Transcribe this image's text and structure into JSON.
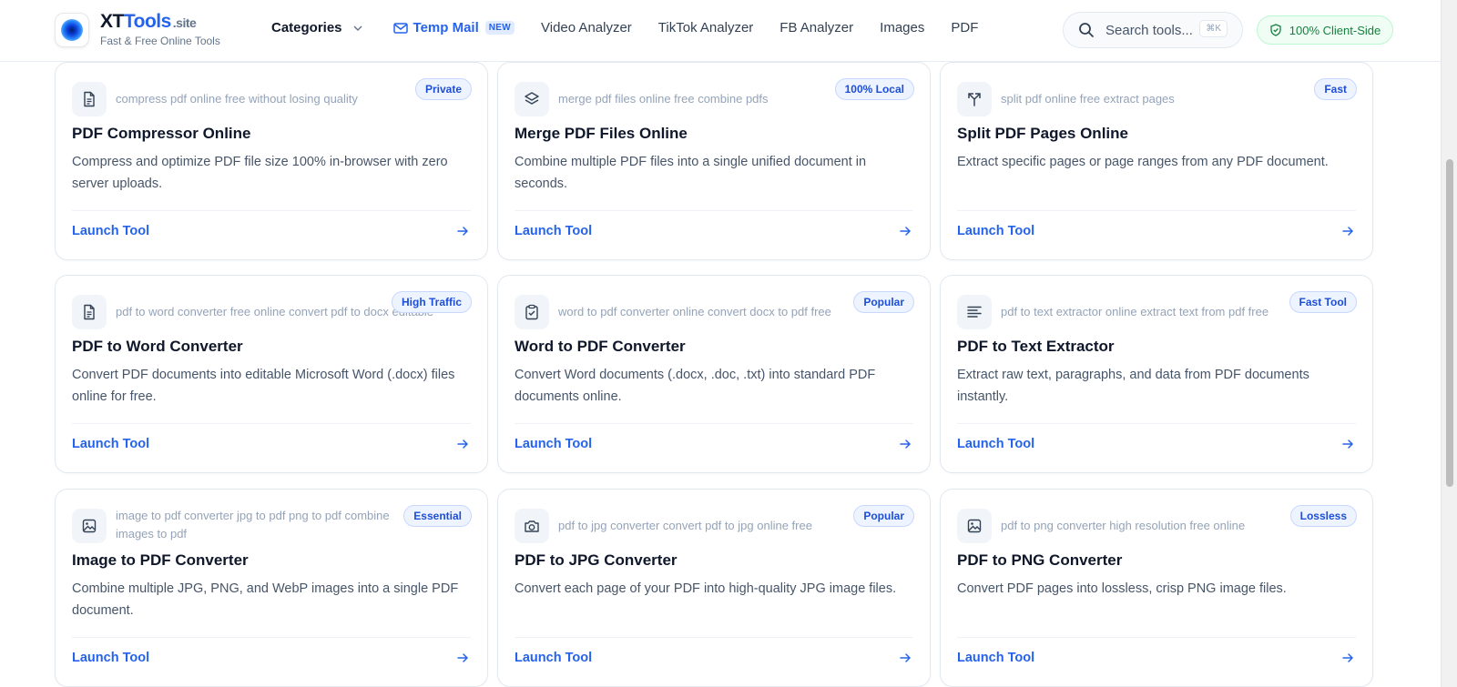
{
  "brand": {
    "name_part1": "XT",
    "name_part2": "Tools",
    "tld": ".site",
    "tagline": "Fast & Free Online Tools"
  },
  "nav": {
    "categories": "Categories",
    "temp_mail": "Temp Mail",
    "new_badge": "NEW",
    "video_analyzer": "Video Analyzer",
    "tiktok_analyzer": "TikTok Analyzer",
    "fb_analyzer": "FB Analyzer",
    "images": "Images",
    "pdf": "PDF"
  },
  "search": {
    "placeholder": "Search tools...",
    "shortcut": "⌘K"
  },
  "client_badge": "100% Client-Side",
  "colors": {
    "accent": "#2563eb",
    "success": "#15803d",
    "badge_bg": "#eef4ff"
  },
  "cards": [
    {
      "icon": "document-icon",
      "keywords": "compress pdf online free without losing quality",
      "badge": "Private",
      "title": "PDF Compressor Online",
      "description": "Compress and optimize PDF file size 100% in-browser with zero server uploads.",
      "cta": "Launch Tool"
    },
    {
      "icon": "layers-icon",
      "keywords": "merge pdf files online free combine pdfs",
      "badge": "100% Local",
      "title": "Merge PDF Files Online",
      "description": "Combine multiple PDF files into a single unified document in seconds.",
      "cta": "Launch Tool"
    },
    {
      "icon": "split-icon",
      "keywords": "split pdf online free extract pages",
      "badge": "Fast",
      "title": "Split PDF Pages Online",
      "description": "Extract specific pages or page ranges from any PDF document.",
      "cta": "Launch Tool"
    },
    {
      "icon": "document-icon",
      "keywords": "pdf to word converter free online convert pdf to docx editable",
      "badge": "High Traffic",
      "title": "PDF to Word Converter",
      "description": "Convert PDF documents into editable Microsoft Word (.docx) files online for free.",
      "cta": "Launch Tool"
    },
    {
      "icon": "clipboard-check-icon",
      "keywords": "word to pdf converter online convert docx to pdf free",
      "badge": "Popular",
      "title": "Word to PDF Converter",
      "description": "Convert Word documents (.docx, .doc, .txt) into standard PDF documents online.",
      "cta": "Launch Tool"
    },
    {
      "icon": "text-align-icon",
      "keywords": "pdf to text extractor online extract text from pdf free",
      "badge": "Fast Tool",
      "title": "PDF to Text Extractor",
      "description": "Extract raw text, paragraphs, and data from PDF documents instantly.",
      "cta": "Launch Tool"
    },
    {
      "icon": "image-icon",
      "keywords": "image to pdf converter jpg to pdf png to pdf combine images to pdf",
      "badge": "Essential",
      "title": "Image to PDF Converter",
      "description": "Combine multiple JPG, PNG, and WebP images into a single PDF document.",
      "cta": "Launch Tool"
    },
    {
      "icon": "camera-icon",
      "keywords": "pdf to jpg converter convert pdf to jpg online free",
      "badge": "Popular",
      "title": "PDF to JPG Converter",
      "description": "Convert each page of your PDF into high-quality JPG image files.",
      "cta": "Launch Tool"
    },
    {
      "icon": "image-icon",
      "keywords": "pdf to png converter high resolution free online",
      "badge": "Lossless",
      "title": "PDF to PNG Converter",
      "description": "Convert PDF pages into lossless, crisp PNG image files.",
      "cta": "Launch Tool"
    }
  ]
}
